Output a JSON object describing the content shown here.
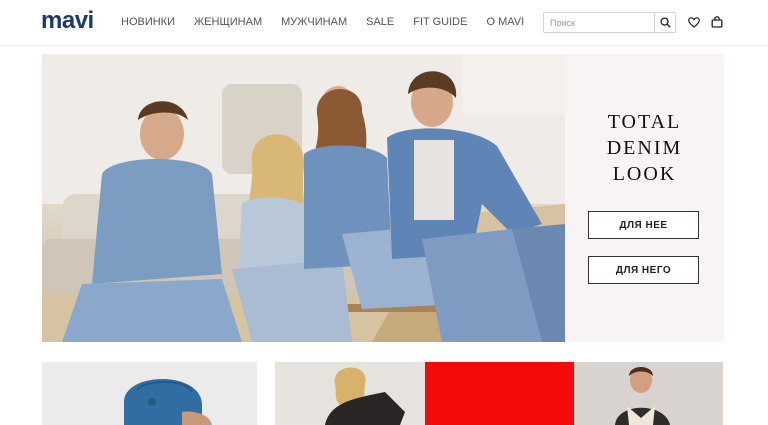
{
  "header": {
    "logo": "mavi",
    "nav": [
      "НОВИНКИ",
      "ЖЕНЩИНАМ",
      "МУЖЧИНАМ",
      "SALE",
      "FIT GUIDE",
      "О MAVI"
    ],
    "search_placeholder": "Поиск",
    "icons": [
      "search-icon",
      "heart-icon",
      "bag-icon"
    ]
  },
  "hero": {
    "title_lines": [
      "TOTAL",
      "DENIM",
      "LOOK"
    ],
    "button_her": "ДЛЯ НЕЕ",
    "button_him": "ДЛЯ НЕГО"
  },
  "colors": {
    "brand": "#1b3a6b",
    "denim": "#6f8fb6",
    "red_tile": "#f50a0a",
    "panel_bg": "#f8f4f4"
  }
}
